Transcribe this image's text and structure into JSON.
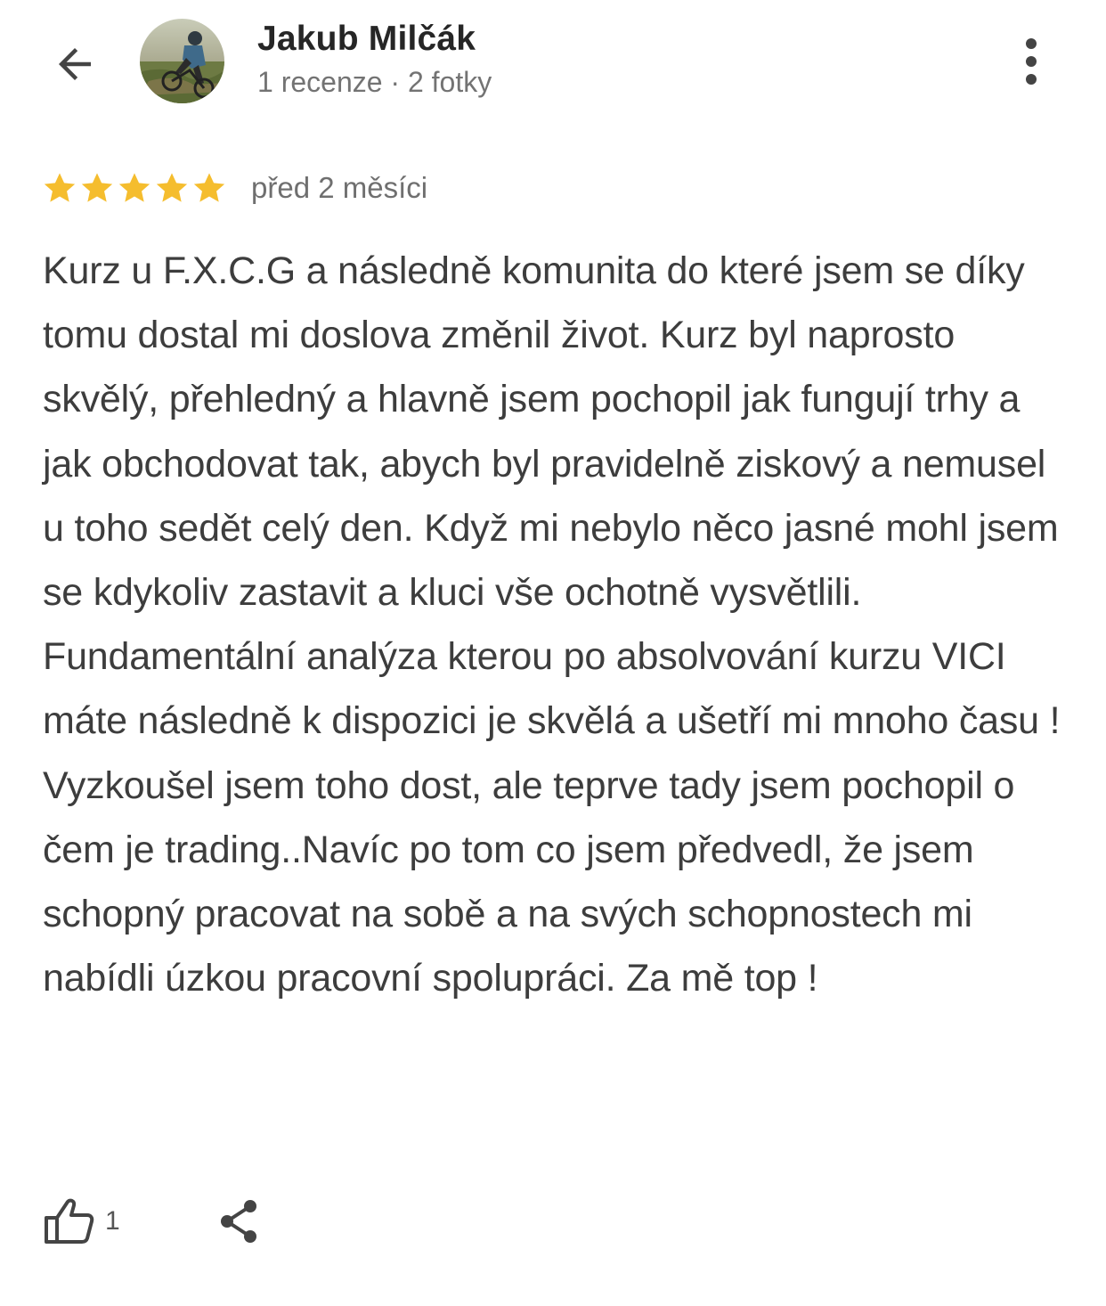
{
  "header": {
    "author_name": "Jakub Milčák",
    "author_meta": "1 recenze · 2 fotky",
    "back_icon": "arrow-back-icon",
    "more_icon": "more-vert-icon"
  },
  "review": {
    "rating": 5,
    "rating_max": 5,
    "date": "před 2 měsíci",
    "text": "Kurz u F.X.C.G a následně komunita do které jsem se díky tomu dostal mi doslova změnil život. Kurz byl naprosto skvělý, přehledný a hlavně jsem pochopil jak fungují trhy a jak obchodovat tak, abych byl pravidelně ziskový a nemusel u toho sedět celý den. Když mi nebylo něco jasné mohl jsem se kdykoliv zastavit a kluci vše ochotně vysvětlili. Fundamentální analýza kterou po absolvování kurzu VICI máte následně k dispozici je skvělá a ušetří mi mnoho času ! Vyzkoušel jsem toho dost, ale teprve tady jsem pochopil o čem je trading..Navíc po tom co jsem předvedl, že jsem schopný pracovat na sobě a na svých schopnostech mi nabídli úzkou pracovní spolupráci. Za mě top !"
  },
  "actions": {
    "like_count": "1",
    "like_icon": "thumb-up-icon",
    "share_icon": "share-icon"
  },
  "colors": {
    "star": "#F5BD2E",
    "name": "#262626",
    "meta": "#737373",
    "body_text": "#3d3d3d",
    "icon": "#444444"
  }
}
